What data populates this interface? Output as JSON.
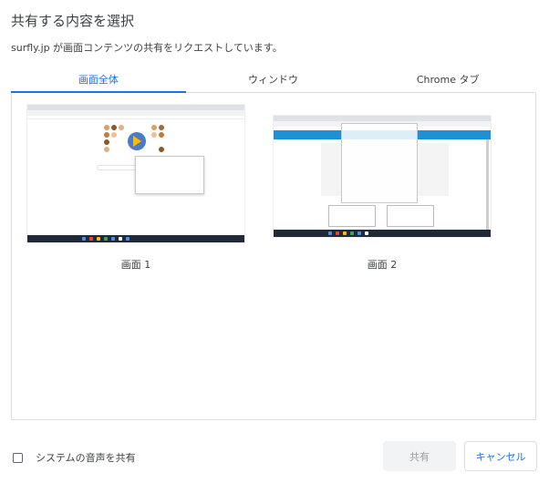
{
  "dialog": {
    "title": "共有する内容を選択",
    "subtitle": "surfly.jp が画面コンテンツの共有をリクエストしています。"
  },
  "tabs": [
    {
      "label": "画面全体",
      "active": true
    },
    {
      "label": "ウィンドウ",
      "active": false
    },
    {
      "label": "Chrome タブ",
      "active": false
    }
  ],
  "screens": [
    {
      "label": "画面 1"
    },
    {
      "label": "画面 2"
    }
  ],
  "footer": {
    "system_audio_label": "システムの音声を共有",
    "system_audio_checked": false,
    "share_label": "共有",
    "share_enabled": false,
    "cancel_label": "キャンセル"
  },
  "colors": {
    "accent": "#1a73e8",
    "text": "#3c4043",
    "border": "#dadce0",
    "disabled_bg": "#f1f3f4"
  }
}
